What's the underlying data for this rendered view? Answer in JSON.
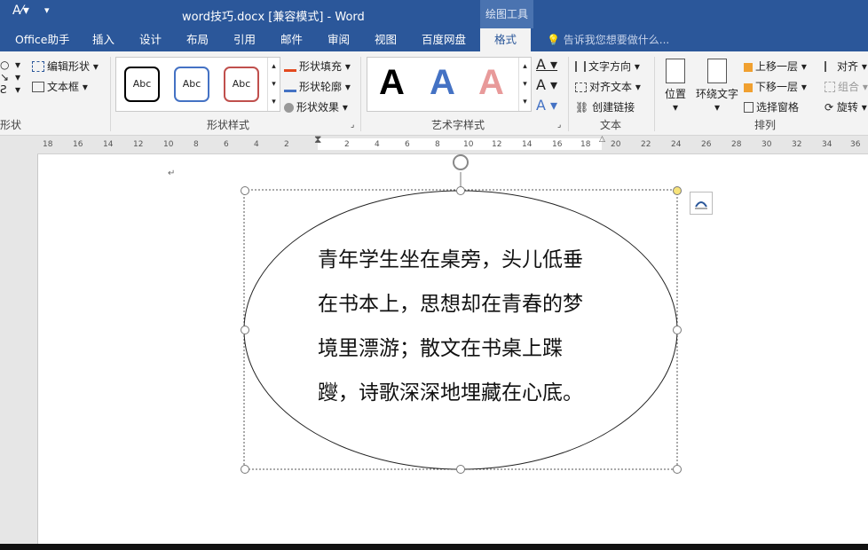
{
  "window": {
    "title": "word技巧.docx [兼容模式] - Word",
    "context_tab_group": "绘图工具"
  },
  "tabs": [
    "Office助手",
    "插入",
    "设计",
    "布局",
    "引用",
    "邮件",
    "审阅",
    "视图",
    "百度网盘",
    "格式"
  ],
  "tell_me": {
    "placeholder": "告诉我您想要做什么..."
  },
  "ribbon": {
    "insert_shapes": {
      "label": "形状",
      "edit_shape": "编辑形状",
      "text_box": "文本框"
    },
    "shape_styles": {
      "label": "形状样式",
      "items": [
        "Abc",
        "Abc",
        "Abc"
      ],
      "fill": "形状填充",
      "outline": "形状轮廓",
      "effects": "形状效果"
    },
    "wordart_styles": {
      "label": "艺术字样式",
      "letters": [
        "A",
        "A",
        "A"
      ]
    },
    "text": {
      "label": "文本",
      "direction": "文字方向",
      "align": "对齐文本",
      "link": "创建链接"
    },
    "arrange": {
      "label": "排列",
      "position": "位置",
      "wrap": "环绕文字",
      "forward": "上移一层",
      "backward": "下移一层",
      "selection_pane": "选择窗格",
      "align": "对齐",
      "group": "组合",
      "rotate": "旋转"
    }
  },
  "ruler": {
    "left_ticks": [
      "18",
      "16",
      "14",
      "12",
      "10",
      "8",
      "6",
      "4",
      "2"
    ],
    "right_ticks": [
      "2",
      "4",
      "6",
      "8",
      "10",
      "12",
      "14",
      "16",
      "18",
      "20",
      "22",
      "24",
      "26",
      "28",
      "30",
      "32",
      "34",
      "36"
    ]
  },
  "document": {
    "lines": [
      "青年学生坐在桌旁，头儿低垂",
      "在书本上，思想却在青春的梦",
      "境里漂游；散文在书桌上蹀",
      "躞，诗歌深深地埋藏在心底。"
    ]
  },
  "colors": {
    "accent": "#2b579a"
  }
}
